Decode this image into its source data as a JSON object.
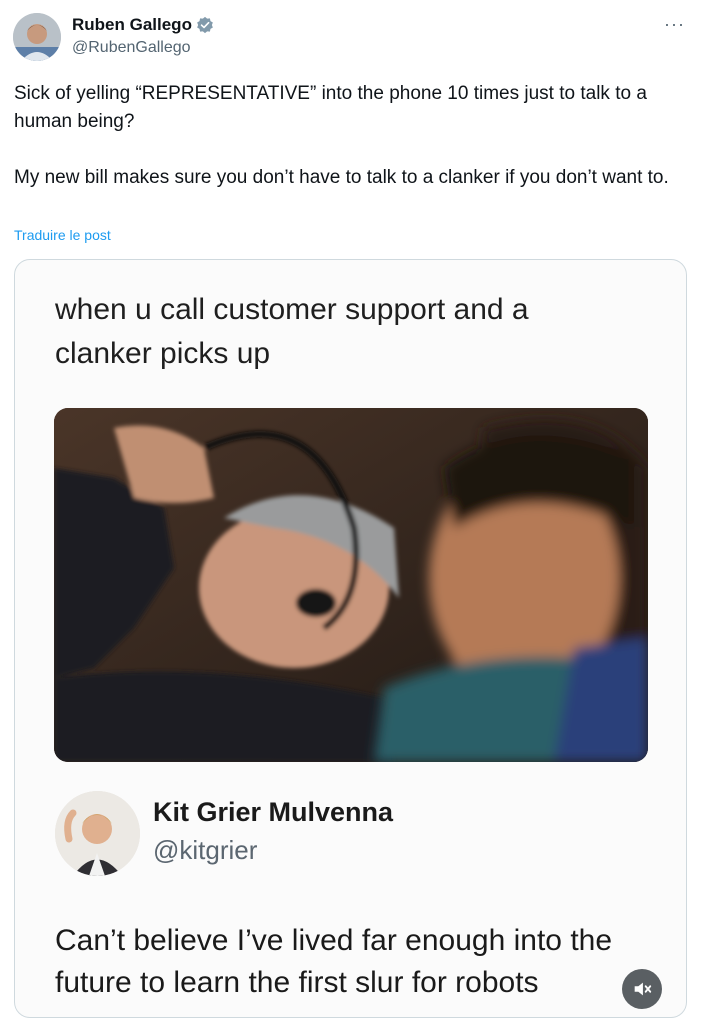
{
  "post": {
    "author_name": "Ruben Gallego",
    "author_handle": "@RubenGallego",
    "verified_icon": "verified-badge-icon",
    "more_icon": "more-options-icon",
    "text": "Sick of yelling “REPRESENTATIVE” into the phone 10 times just to talk to a human being?\n\nMy new bill makes sure you don’t have to talk to a clanker if you don’t want to.",
    "translate_label": "Traduire le post"
  },
  "media": {
    "caption": "when u call customer support and a clanker picks up",
    "quoted": {
      "name": "Kit Grier Mulvenna",
      "handle": "@kitgrier",
      "text": "Can’t believe I’ve lived far enough into the future to learn the first slur for robots"
    },
    "mute_icon": "volume-muted-icon"
  },
  "colors": {
    "link": "#1d9bf0",
    "verified": "#829aab",
    "secondary_text": "#536471",
    "card_border": "#cfd9de"
  }
}
